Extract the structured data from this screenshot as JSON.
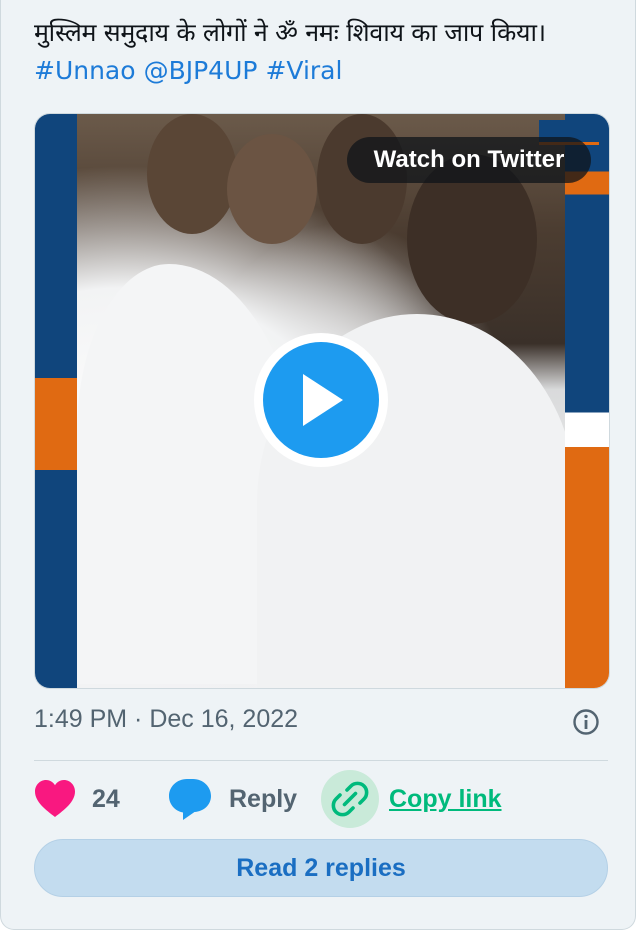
{
  "tweet": {
    "text": "मुस्लिम समुदाय के लोगों ने ॐ नमः शिवाय का जाप किया।",
    "hashtags": [
      "#Unnao",
      "@BJP4UP",
      "#Viral"
    ]
  },
  "media": {
    "watch_label": "Watch on Twitter"
  },
  "meta": {
    "timestamp": "1:49 PM · Dec 16, 2022"
  },
  "actions": {
    "like_count": "24",
    "reply_label": "Reply",
    "copy_label": "Copy link"
  },
  "read_replies_label": "Read 2 replies",
  "colors": {
    "like": "#f91880",
    "reply": "#1d9bf0",
    "copy": "#00ba7c",
    "link": "#1d7bd8",
    "frame_blue": "#10457c",
    "frame_orange": "#e06a12"
  }
}
